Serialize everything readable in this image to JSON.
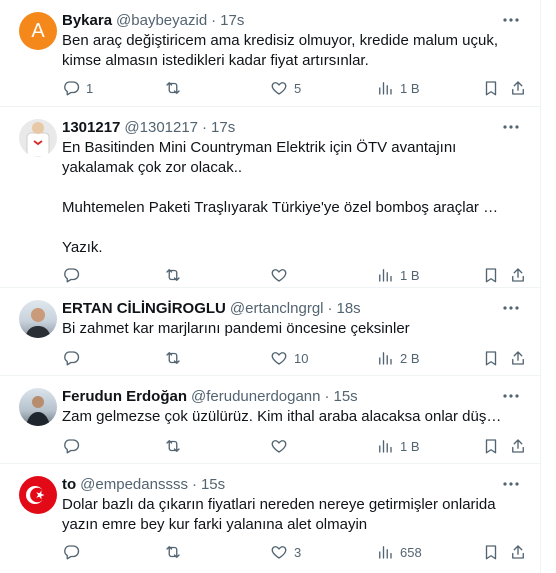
{
  "tweets": [
    {
      "avatar_letter": "A",
      "name": "Bykara",
      "handle": "@baybeyazid",
      "sep": "·",
      "time": "17s",
      "text": "Ben araç değiştiricem ama kredisiz olmuyor, kredide malum uçuk, kimse almasın istedikleri kadar fiyat artırsınlar.",
      "replies": "1",
      "retweets": "",
      "likes": "5",
      "views": "1 B"
    },
    {
      "name": "1301217",
      "handle": "@1301217",
      "sep": "·",
      "time": "17s",
      "text": "En Basitinden Mini Countryman Elektrik için ÖTV avantajını yakalamak çok zor olacak..",
      "text2": "Muhtemelen Paketi Traşlıyarak Türkiye'ye özel bomboş araçlar getirilecek...",
      "text3": "Yazık.",
      "replies": "",
      "retweets": "",
      "likes": "",
      "views": "1 B"
    },
    {
      "name": "ERTAN CİLİNGİROGLU",
      "handle": "@ertanclngrgl",
      "sep": "·",
      "time": "18s",
      "text": "Bi zahmet kar marjlarını pandemi öncesine çeksinler",
      "replies": "",
      "retweets": "",
      "likes": "10",
      "views": "2 B"
    },
    {
      "name": "Ferudun Erdoğan",
      "handle": "@ferudunerdogann",
      "sep": "·",
      "time": "15s",
      "text": "Zam gelmezse çok üzülürüz. Kim ithal araba alacaksa onlar düşünsün...",
      "replies": "",
      "retweets": "",
      "likes": "",
      "views": "1 B"
    },
    {
      "name": "to",
      "handle": "@empedanssss",
      "sep": "·",
      "time": "15s",
      "text": "Dolar bazlı da çıkarın fiyatlari nereden nereye getirmişler onlarida yazın emre bey kur farki yalanına alet olmayin",
      "replies": "",
      "retweets": "",
      "likes": "3",
      "views": "658"
    }
  ]
}
